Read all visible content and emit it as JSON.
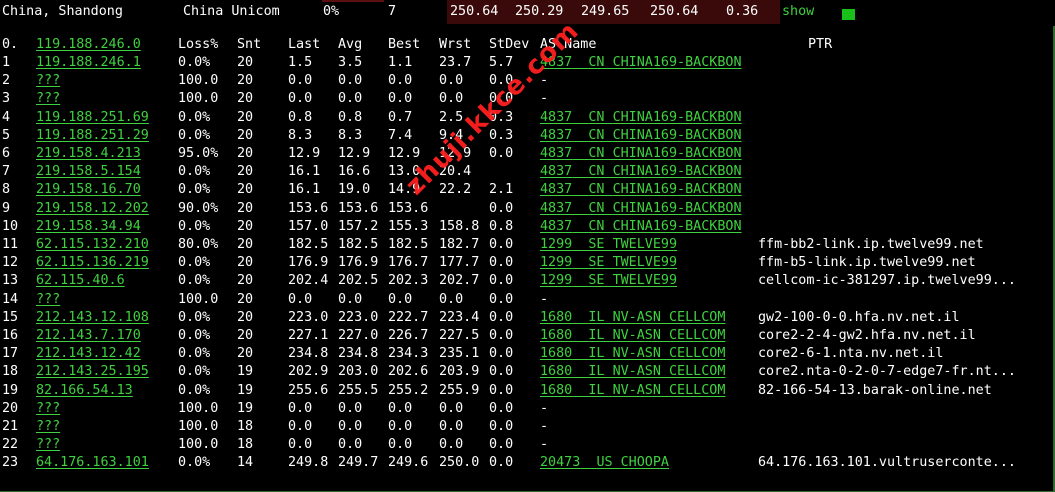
{
  "top_bar": {
    "location": "China, Shandong",
    "isp": "China Unicom",
    "loss": "0%",
    "count": "7",
    "metrics": [
      "250.64",
      "250.29",
      "249.65",
      "250.64",
      "0.36"
    ],
    "show_label": "show"
  },
  "colors": {
    "link_green": "#3fd13f",
    "metrics_bg": "#3a0a0a",
    "status_square": "#19c019",
    "watermark_red": "#ff2020"
  },
  "headers": {
    "index": "0.",
    "host": "119.188.246.0",
    "loss": "Loss%",
    "snt": "Snt",
    "last": "Last",
    "avg": "Avg",
    "best": "Best",
    "wrst": "Wrst",
    "stdev": "StDev",
    "as_name": "AS Name",
    "ptr": "PTR"
  },
  "hops": [
    {
      "idx": "1",
      "host": "119.188.246.1",
      "loss": "0.0%",
      "snt": "20",
      "last": "1.5",
      "avg": "3.5",
      "best": "1.1",
      "wrst": "23.7",
      "stdev": "5.7",
      "asn": "4837",
      "cc": "CN",
      "asname": "CHINA169-BACKBON",
      "ptr": ""
    },
    {
      "idx": "2",
      "host": "???",
      "loss": "100.0",
      "snt": "20",
      "last": "0.0",
      "avg": "0.0",
      "best": "0.0",
      "wrst": "0.0",
      "stdev": "0.0",
      "asn": "",
      "cc": "",
      "asname": "",
      "dash": "-",
      "ptr": ""
    },
    {
      "idx": "3",
      "host": "???",
      "loss": "100.0",
      "snt": "20",
      "last": "0.0",
      "avg": "0.0",
      "best": "0.0",
      "wrst": "0.0",
      "stdev": "0.0",
      "asn": "",
      "cc": "",
      "asname": "",
      "dash": "-",
      "ptr": ""
    },
    {
      "idx": "4",
      "host": "119.188.251.69",
      "loss": "0.0%",
      "snt": "20",
      "last": "0.8",
      "avg": "0.8",
      "best": "0.7",
      "wrst": "2.5",
      "stdev": "0.3",
      "asn": "4837",
      "cc": "CN",
      "asname": "CHINA169-BACKBON",
      "ptr": ""
    },
    {
      "idx": "5",
      "host": "119.188.251.29",
      "loss": "0.0%",
      "snt": "20",
      "last": "8.3",
      "avg": "8.3",
      "best": "7.4",
      "wrst": "9.4",
      "stdev": "0.3",
      "asn": "4837",
      "cc": "CN",
      "asname": "CHINA169-BACKBON",
      "ptr": ""
    },
    {
      "idx": "6",
      "host": "219.158.4.213",
      "loss": "95.0%",
      "snt": "20",
      "last": "12.9",
      "avg": "12.9",
      "best": "12.9",
      "wrst": "12.9",
      "stdev": "0.0",
      "asn": "4837",
      "cc": "CN",
      "asname": "CHINA169-BACKBON",
      "ptr": ""
    },
    {
      "idx": "7",
      "host": "219.158.5.154",
      "loss": "0.0%",
      "snt": "20",
      "last": "16.1",
      "avg": "16.6",
      "best": "13.0",
      "wrst": "20.4",
      "stdev": "",
      "asn": "4837",
      "cc": "CN",
      "asname": "CHINA169-BACKBON",
      "ptr": ""
    },
    {
      "idx": "8",
      "host": "219.158.16.70",
      "loss": "0.0%",
      "snt": "20",
      "last": "16.1",
      "avg": "19.0",
      "best": "14.9",
      "wrst": "22.2",
      "stdev": "2.1",
      "asn": "4837",
      "cc": "CN",
      "asname": "CHINA169-BACKBON",
      "ptr": ""
    },
    {
      "idx": "9",
      "host": "219.158.12.202",
      "loss": "90.0%",
      "snt": "20",
      "last": "153.6",
      "avg": "153.6",
      "best": "153.6",
      "wrst": "",
      "stdev": "0.0",
      "asn": "4837",
      "cc": "CN",
      "asname": "CHINA169-BACKBON",
      "ptr": ""
    },
    {
      "idx": "10",
      "host": "219.158.34.94",
      "loss": "0.0%",
      "snt": "20",
      "last": "157.0",
      "avg": "157.2",
      "best": "155.3",
      "wrst": "158.8",
      "stdev": "0.8",
      "asn": "4837",
      "cc": "CN",
      "asname": "CHINA169-BACKBON",
      "ptr": ""
    },
    {
      "idx": "11",
      "host": "62.115.132.210",
      "loss": "80.0%",
      "snt": "20",
      "last": "182.5",
      "avg": "182.5",
      "best": "182.5",
      "wrst": "182.7",
      "stdev": "0.0",
      "asn": "1299",
      "cc": "SE",
      "asname": "TWELVE99",
      "ptr": "ffm-bb2-link.ip.twelve99.net"
    },
    {
      "idx": "12",
      "host": "62.115.136.219",
      "loss": "0.0%",
      "snt": "20",
      "last": "176.9",
      "avg": "176.9",
      "best": "176.7",
      "wrst": "177.7",
      "stdev": "0.0",
      "asn": "1299",
      "cc": "SE",
      "asname": "TWELVE99",
      "ptr": "ffm-b5-link.ip.twelve99.net"
    },
    {
      "idx": "13",
      "host": "62.115.40.6",
      "loss": "0.0%",
      "snt": "20",
      "last": "202.4",
      "avg": "202.5",
      "best": "202.3",
      "wrst": "202.7",
      "stdev": "0.0",
      "asn": "1299",
      "cc": "SE",
      "asname": "TWELVE99",
      "ptr": "cellcom-ic-381297.ip.twelve99..."
    },
    {
      "idx": "14",
      "host": "???",
      "loss": "100.0",
      "snt": "20",
      "last": "0.0",
      "avg": "0.0",
      "best": "0.0",
      "wrst": "0.0",
      "stdev": "0.0",
      "asn": "",
      "cc": "",
      "asname": "",
      "dash": "-",
      "ptr": ""
    },
    {
      "idx": "15",
      "host": "212.143.12.108",
      "loss": "0.0%",
      "snt": "20",
      "last": "223.0",
      "avg": "223.0",
      "best": "222.7",
      "wrst": "223.4",
      "stdev": "0.0",
      "asn": "1680",
      "cc": "IL",
      "asname": "NV-ASN CELLCOM",
      "ptr": "gw2-100-0-0.hfa.nv.net.il"
    },
    {
      "idx": "16",
      "host": "212.143.7.170",
      "loss": "0.0%",
      "snt": "20",
      "last": "227.1",
      "avg": "227.0",
      "best": "226.7",
      "wrst": "227.5",
      "stdev": "0.0",
      "asn": "1680",
      "cc": "IL",
      "asname": "NV-ASN CELLCOM",
      "ptr": "core2-2-4-gw2.hfa.nv.net.il"
    },
    {
      "idx": "17",
      "host": "212.143.12.42",
      "loss": "0.0%",
      "snt": "20",
      "last": "234.8",
      "avg": "234.8",
      "best": "234.3",
      "wrst": "235.1",
      "stdev": "0.0",
      "asn": "1680",
      "cc": "IL",
      "asname": "NV-ASN CELLCOM",
      "ptr": "core2-6-1.nta.nv.net.il"
    },
    {
      "idx": "18",
      "host": "212.143.25.195",
      "loss": "0.0%",
      "snt": "19",
      "last": "202.9",
      "avg": "203.0",
      "best": "202.6",
      "wrst": "203.9",
      "stdev": "0.0",
      "asn": "1680",
      "cc": "IL",
      "asname": "NV-ASN CELLCOM",
      "ptr": "core2.nta-0-2-0-7-edge7-fr.nt..."
    },
    {
      "idx": "19",
      "host": "82.166.54.13",
      "loss": "0.0%",
      "snt": "19",
      "last": "255.6",
      "avg": "255.5",
      "best": "255.2",
      "wrst": "255.9",
      "stdev": "0.0",
      "asn": "1680",
      "cc": "IL",
      "asname": "NV-ASN CELLCOM",
      "ptr": "82-166-54-13.barak-online.net"
    },
    {
      "idx": "20",
      "host": "???",
      "loss": "100.0",
      "snt": "19",
      "last": "0.0",
      "avg": "0.0",
      "best": "0.0",
      "wrst": "0.0",
      "stdev": "0.0",
      "asn": "",
      "cc": "",
      "asname": "",
      "dash": "-",
      "ptr": ""
    },
    {
      "idx": "21",
      "host": "???",
      "loss": "100.0",
      "snt": "18",
      "last": "0.0",
      "avg": "0.0",
      "best": "0.0",
      "wrst": "0.0",
      "stdev": "0.0",
      "asn": "",
      "cc": "",
      "asname": "",
      "dash": "-",
      "ptr": ""
    },
    {
      "idx": "22",
      "host": "???",
      "loss": "100.0",
      "snt": "18",
      "last": "0.0",
      "avg": "0.0",
      "best": "0.0",
      "wrst": "0.0",
      "stdev": "0.0",
      "asn": "",
      "cc": "",
      "asname": "",
      "dash": "-",
      "ptr": ""
    },
    {
      "idx": "23",
      "host": "64.176.163.101",
      "loss": "0.0%",
      "snt": "14",
      "last": "249.8",
      "avg": "249.7",
      "best": "249.6",
      "wrst": "250.0",
      "stdev": "0.0",
      "asn": "20473",
      "cc": "US",
      "asname": "CHOOPA",
      "ptr": "64.176.163.101.vultrusercontе..."
    }
  ],
  "watermark": "zhuji.kkce.com"
}
